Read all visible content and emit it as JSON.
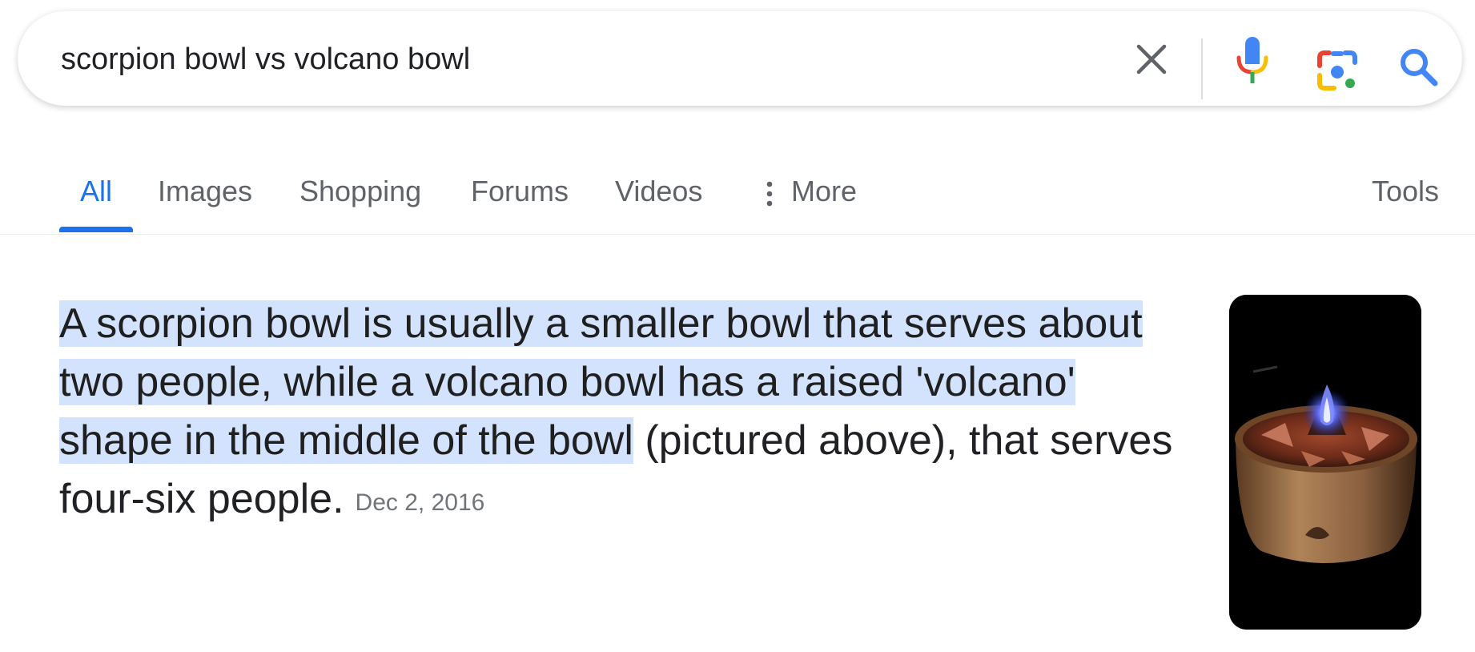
{
  "search": {
    "query": "scorpion bowl vs volcano bowl"
  },
  "icons": {
    "clear": "close-icon",
    "voice": "microphone-icon",
    "lens": "camera-lens-icon",
    "search": "search-icon",
    "more": "three-dots-vertical-icon"
  },
  "tabs": [
    {
      "label": "All",
      "active": true
    },
    {
      "label": "Images"
    },
    {
      "label": "Shopping"
    },
    {
      "label": "Forums"
    },
    {
      "label": "Videos"
    },
    {
      "label": "More"
    }
  ],
  "tools_label": "Tools",
  "answer": {
    "highlighted_text": "A scorpion bowl is usually a smaller bowl that serves about two people, while a volcano bowl has a raised 'volcano' shape in the middle of the bowl",
    "rest_text": " (pictured above), that serves four-six people.",
    "date": "Dec 2, 2016"
  },
  "colors": {
    "accent": "#1a73e8",
    "highlight": "#d3e3fd",
    "tab_text": "#5f6368",
    "body_text": "#202124"
  }
}
